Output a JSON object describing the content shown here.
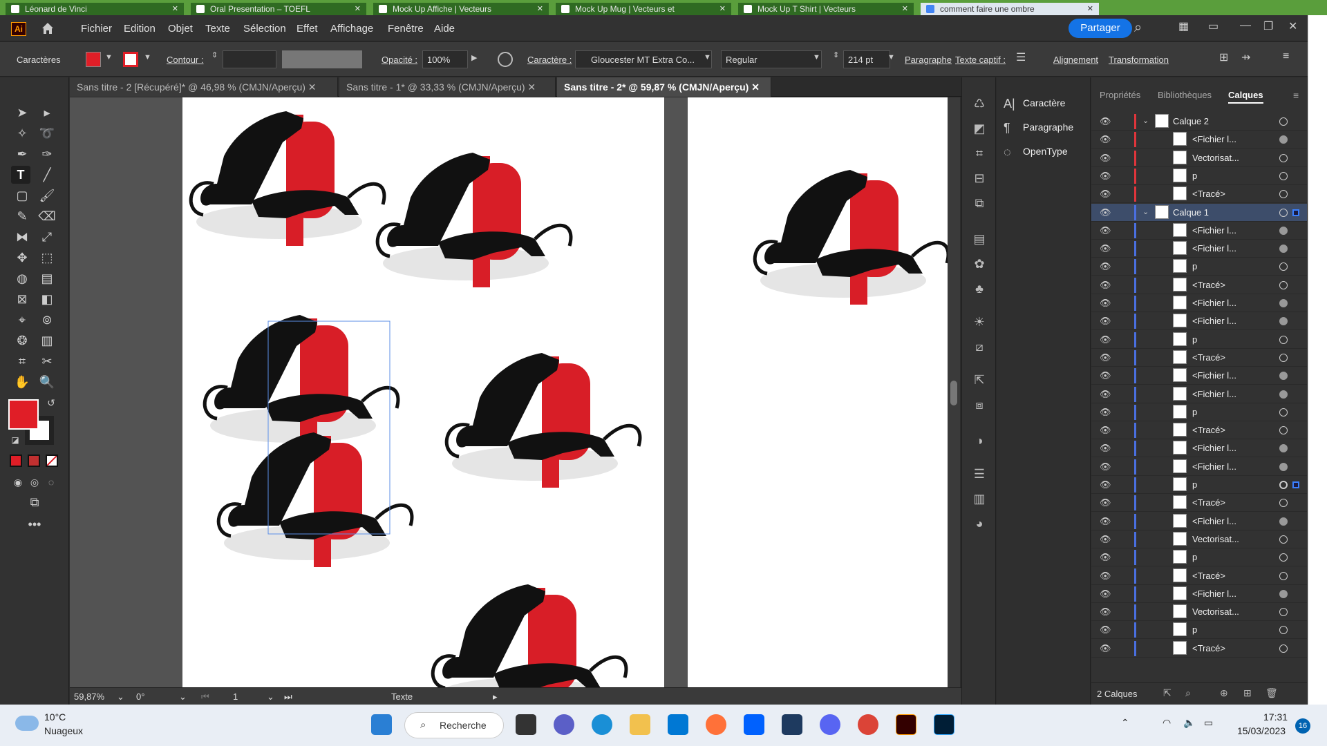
{
  "browser_tabs": [
    "Léonard de Vinci",
    "Oral Presentation – TOEFL",
    "Mock Up Affiche | Vecteurs",
    "Mock Up Mug | Vecteurs et",
    "Mock Up T Shirt | Vecteurs",
    "comment faire une ombre"
  ],
  "app": {
    "logo": "Ai"
  },
  "menu": [
    "Fichier",
    "Edition",
    "Objet",
    "Texte",
    "Sélection",
    "Effet",
    "Affichage",
    "Fenêtre",
    "Aide"
  ],
  "share_label": "Partager",
  "control_bar": {
    "section": "Caractères",
    "contour_label": "Contour :",
    "opacity_label": "Opacité :",
    "opacity_value": "100%",
    "character_label": "Caractère :",
    "font_name": "Gloucester MT Extra Co...",
    "font_style": "Regular",
    "font_size": "214 pt",
    "paragraph_label": "Paragraphe",
    "captive_text_label": "Texte captif :",
    "align_label": "Alignement",
    "transform_label": "Transformation"
  },
  "doc_tabs": [
    {
      "label": "Sans titre - 2 [Récupéré]* @ 46,98 % (CMJN/Aperçu)"
    },
    {
      "label": "Sans titre - 1* @ 33,33 % (CMJN/Aperçu)"
    },
    {
      "label": "Sans titre - 2* @ 59,87 % (CMJN/Aperçu)"
    }
  ],
  "status": {
    "zoom": "59,87%",
    "rotation": "0°",
    "artboard": "1",
    "tool": "Texte"
  },
  "char_panel": {
    "items": [
      "Caractère",
      "Paragraphe",
      "OpenType"
    ]
  },
  "layers_panel": {
    "tabs": [
      "Propriétés",
      "Bibliothèques",
      "Calques"
    ],
    "rows": [
      {
        "name": "Calque 2",
        "type": "layer",
        "color": "#e0353b",
        "target": "empty"
      },
      {
        "name": "<Fichier l...",
        "type": "item",
        "color": "#e0353b",
        "target": "filled"
      },
      {
        "name": "Vectorisat...",
        "type": "item",
        "color": "#e0353b",
        "target": "empty"
      },
      {
        "name": "p",
        "type": "item",
        "color": "#e0353b",
        "target": "empty"
      },
      {
        "name": "<Tracé>",
        "type": "item",
        "color": "#e0353b",
        "target": "empty"
      },
      {
        "name": "Calque 1",
        "type": "layer",
        "color": "#4a6fe0",
        "target": "empty",
        "selected": true
      },
      {
        "name": "<Fichier l...",
        "type": "item",
        "color": "#4a6fe0",
        "target": "filled"
      },
      {
        "name": "<Fichier l...",
        "type": "item",
        "color": "#4a6fe0",
        "target": "filled"
      },
      {
        "name": "p",
        "type": "item",
        "color": "#4a6fe0",
        "target": "empty"
      },
      {
        "name": "<Tracé>",
        "type": "item",
        "color": "#4a6fe0",
        "target": "empty"
      },
      {
        "name": "<Fichier l...",
        "type": "item",
        "color": "#4a6fe0",
        "target": "filled"
      },
      {
        "name": "<Fichier l...",
        "type": "item",
        "color": "#4a6fe0",
        "target": "filled"
      },
      {
        "name": "p",
        "type": "item",
        "color": "#4a6fe0",
        "target": "empty"
      },
      {
        "name": "<Tracé>",
        "type": "item",
        "color": "#4a6fe0",
        "target": "empty"
      },
      {
        "name": "<Fichier l...",
        "type": "item",
        "color": "#4a6fe0",
        "target": "filled"
      },
      {
        "name": "<Fichier l...",
        "type": "item",
        "color": "#4a6fe0",
        "target": "filled"
      },
      {
        "name": "p",
        "type": "item",
        "color": "#4a6fe0",
        "target": "empty"
      },
      {
        "name": "<Tracé>",
        "type": "item",
        "color": "#4a6fe0",
        "target": "empty"
      },
      {
        "name": "<Fichier l...",
        "type": "item",
        "color": "#4a6fe0",
        "target": "filled"
      },
      {
        "name": "<Fichier l...",
        "type": "item",
        "color": "#4a6fe0",
        "target": "filled"
      },
      {
        "name": "p",
        "type": "item",
        "color": "#4a6fe0",
        "target": "ring",
        "selected_indicator": true
      },
      {
        "name": "<Tracé>",
        "type": "item",
        "color": "#4a6fe0",
        "target": "empty"
      },
      {
        "name": "<Fichier l...",
        "type": "item",
        "color": "#4a6fe0",
        "target": "filled"
      },
      {
        "name": "Vectorisat...",
        "type": "item",
        "color": "#4a6fe0",
        "target": "empty"
      },
      {
        "name": "p",
        "type": "item",
        "color": "#4a6fe0",
        "target": "empty"
      },
      {
        "name": "<Tracé>",
        "type": "item",
        "color": "#4a6fe0",
        "target": "empty"
      },
      {
        "name": "<Fichier l...",
        "type": "item",
        "color": "#4a6fe0",
        "target": "filled"
      },
      {
        "name": "Vectorisat...",
        "type": "item",
        "color": "#4a6fe0",
        "target": "empty"
      },
      {
        "name": "p",
        "type": "item",
        "color": "#4a6fe0",
        "target": "empty"
      },
      {
        "name": "<Tracé>",
        "type": "item",
        "color": "#4a6fe0",
        "target": "empty"
      }
    ],
    "footer_count": "2 Calques"
  },
  "colors": {
    "fill": "#e01e27",
    "accent": "#1473e6"
  },
  "taskbar": {
    "weather_temp": "10°C",
    "weather_desc": "Nuageux",
    "search": "Recherche",
    "time": "17:31",
    "date": "15/03/2023",
    "notif_count": "16"
  }
}
